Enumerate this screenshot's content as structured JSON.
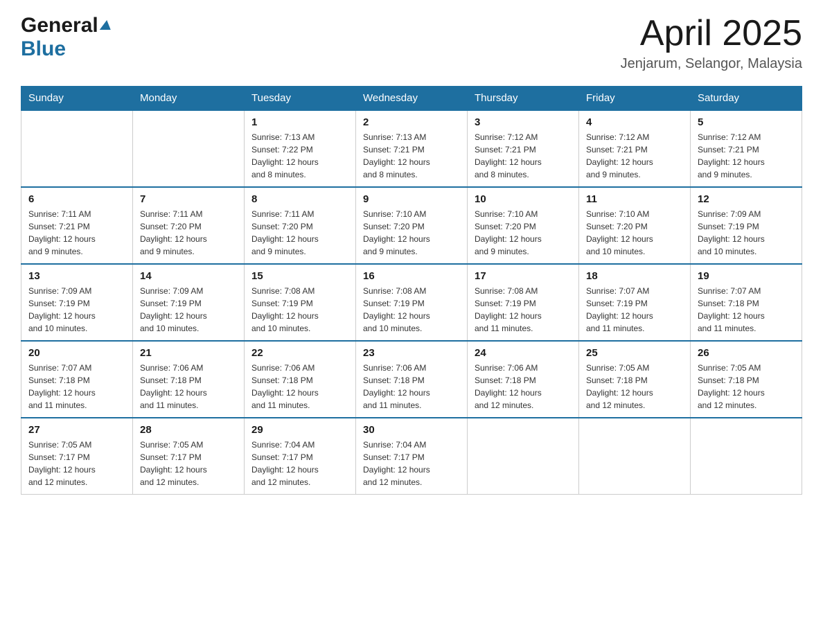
{
  "header": {
    "logo_general": "General",
    "logo_blue": "Blue",
    "month_title": "April 2025",
    "location": "Jenjarum, Selangor, Malaysia"
  },
  "weekdays": [
    "Sunday",
    "Monday",
    "Tuesday",
    "Wednesday",
    "Thursday",
    "Friday",
    "Saturday"
  ],
  "weeks": [
    [
      {
        "day": "",
        "info": ""
      },
      {
        "day": "",
        "info": ""
      },
      {
        "day": "1",
        "info": "Sunrise: 7:13 AM\nSunset: 7:22 PM\nDaylight: 12 hours\nand 8 minutes."
      },
      {
        "day": "2",
        "info": "Sunrise: 7:13 AM\nSunset: 7:21 PM\nDaylight: 12 hours\nand 8 minutes."
      },
      {
        "day": "3",
        "info": "Sunrise: 7:12 AM\nSunset: 7:21 PM\nDaylight: 12 hours\nand 8 minutes."
      },
      {
        "day": "4",
        "info": "Sunrise: 7:12 AM\nSunset: 7:21 PM\nDaylight: 12 hours\nand 9 minutes."
      },
      {
        "day": "5",
        "info": "Sunrise: 7:12 AM\nSunset: 7:21 PM\nDaylight: 12 hours\nand 9 minutes."
      }
    ],
    [
      {
        "day": "6",
        "info": "Sunrise: 7:11 AM\nSunset: 7:21 PM\nDaylight: 12 hours\nand 9 minutes."
      },
      {
        "day": "7",
        "info": "Sunrise: 7:11 AM\nSunset: 7:20 PM\nDaylight: 12 hours\nand 9 minutes."
      },
      {
        "day": "8",
        "info": "Sunrise: 7:11 AM\nSunset: 7:20 PM\nDaylight: 12 hours\nand 9 minutes."
      },
      {
        "day": "9",
        "info": "Sunrise: 7:10 AM\nSunset: 7:20 PM\nDaylight: 12 hours\nand 9 minutes."
      },
      {
        "day": "10",
        "info": "Sunrise: 7:10 AM\nSunset: 7:20 PM\nDaylight: 12 hours\nand 9 minutes."
      },
      {
        "day": "11",
        "info": "Sunrise: 7:10 AM\nSunset: 7:20 PM\nDaylight: 12 hours\nand 10 minutes."
      },
      {
        "day": "12",
        "info": "Sunrise: 7:09 AM\nSunset: 7:19 PM\nDaylight: 12 hours\nand 10 minutes."
      }
    ],
    [
      {
        "day": "13",
        "info": "Sunrise: 7:09 AM\nSunset: 7:19 PM\nDaylight: 12 hours\nand 10 minutes."
      },
      {
        "day": "14",
        "info": "Sunrise: 7:09 AM\nSunset: 7:19 PM\nDaylight: 12 hours\nand 10 minutes."
      },
      {
        "day": "15",
        "info": "Sunrise: 7:08 AM\nSunset: 7:19 PM\nDaylight: 12 hours\nand 10 minutes."
      },
      {
        "day": "16",
        "info": "Sunrise: 7:08 AM\nSunset: 7:19 PM\nDaylight: 12 hours\nand 10 minutes."
      },
      {
        "day": "17",
        "info": "Sunrise: 7:08 AM\nSunset: 7:19 PM\nDaylight: 12 hours\nand 11 minutes."
      },
      {
        "day": "18",
        "info": "Sunrise: 7:07 AM\nSunset: 7:19 PM\nDaylight: 12 hours\nand 11 minutes."
      },
      {
        "day": "19",
        "info": "Sunrise: 7:07 AM\nSunset: 7:18 PM\nDaylight: 12 hours\nand 11 minutes."
      }
    ],
    [
      {
        "day": "20",
        "info": "Sunrise: 7:07 AM\nSunset: 7:18 PM\nDaylight: 12 hours\nand 11 minutes."
      },
      {
        "day": "21",
        "info": "Sunrise: 7:06 AM\nSunset: 7:18 PM\nDaylight: 12 hours\nand 11 minutes."
      },
      {
        "day": "22",
        "info": "Sunrise: 7:06 AM\nSunset: 7:18 PM\nDaylight: 12 hours\nand 11 minutes."
      },
      {
        "day": "23",
        "info": "Sunrise: 7:06 AM\nSunset: 7:18 PM\nDaylight: 12 hours\nand 11 minutes."
      },
      {
        "day": "24",
        "info": "Sunrise: 7:06 AM\nSunset: 7:18 PM\nDaylight: 12 hours\nand 12 minutes."
      },
      {
        "day": "25",
        "info": "Sunrise: 7:05 AM\nSunset: 7:18 PM\nDaylight: 12 hours\nand 12 minutes."
      },
      {
        "day": "26",
        "info": "Sunrise: 7:05 AM\nSunset: 7:18 PM\nDaylight: 12 hours\nand 12 minutes."
      }
    ],
    [
      {
        "day": "27",
        "info": "Sunrise: 7:05 AM\nSunset: 7:17 PM\nDaylight: 12 hours\nand 12 minutes."
      },
      {
        "day": "28",
        "info": "Sunrise: 7:05 AM\nSunset: 7:17 PM\nDaylight: 12 hours\nand 12 minutes."
      },
      {
        "day": "29",
        "info": "Sunrise: 7:04 AM\nSunset: 7:17 PM\nDaylight: 12 hours\nand 12 minutes."
      },
      {
        "day": "30",
        "info": "Sunrise: 7:04 AM\nSunset: 7:17 PM\nDaylight: 12 hours\nand 12 minutes."
      },
      {
        "day": "",
        "info": ""
      },
      {
        "day": "",
        "info": ""
      },
      {
        "day": "",
        "info": ""
      }
    ]
  ]
}
